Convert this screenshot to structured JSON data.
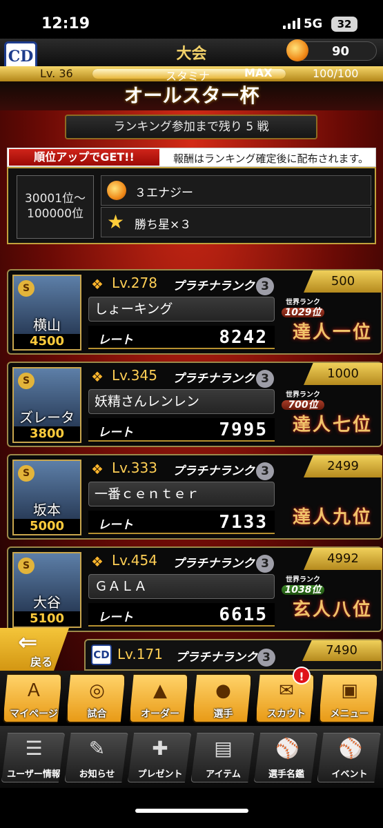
{
  "status": {
    "time": "12:19",
    "network": "5G",
    "battery": "32"
  },
  "header": {
    "logo": "CD",
    "title": "大会",
    "energy": "90"
  },
  "level": {
    "lv": "Lv. 36",
    "stamina_label": "スタミナ",
    "max": "MAX",
    "value": "100/100",
    "stamina_fraction": 1.0
  },
  "cup": {
    "title": "オールスター杯",
    "remaining": "ランキング参加まで残り 5 戦"
  },
  "reward": {
    "banner": "順位アップでGET!!",
    "note": "報酬はランキング確定後に配布されます。",
    "rank_range": [
      "30001位～",
      "100000位"
    ],
    "items": [
      {
        "icon": "energy-icon",
        "label": "３エナジー"
      },
      {
        "icon": "star-icon",
        "label": "勝ち星×３"
      }
    ]
  },
  "ranking": [
    {
      "player": "横山",
      "player_value": "4500",
      "level": "Lv.278",
      "rank_class": "プラチナランク",
      "rank_num": "3",
      "name": "しょーキング",
      "rate_label": "レート",
      "rate": "8242",
      "points": "500",
      "world_rank_label": "世界ランク",
      "world_rank": "1029位",
      "title": "達人一位"
    },
    {
      "player": "ズレータ",
      "player_value": "3800",
      "level": "Lv.345",
      "rank_class": "プラチナランク",
      "rank_num": "3",
      "name": "妖精さんレンレン",
      "rate_label": "レート",
      "rate": "7995",
      "points": "1000",
      "world_rank_label": "世界ランク",
      "world_rank": "700位",
      "title": "達人七位"
    },
    {
      "player": "坂本",
      "player_value": "5000",
      "level": "Lv.333",
      "rank_class": "プラチナランク",
      "rank_num": "3",
      "name": "一番ｃｅｎｔｅｒ",
      "rate_label": "レート",
      "rate": "7133",
      "points": "2499",
      "world_rank_label": "",
      "world_rank": "",
      "title": "達人九位"
    },
    {
      "player": "大谷",
      "player_value": "5100",
      "level": "Lv.454",
      "rank_class": "プラチナランク",
      "rank_num": "3",
      "name": "ＧＡＬＡ",
      "rate_label": "レート",
      "rate": "6615",
      "points": "4992",
      "world_rank_label": "世界ランク",
      "world_rank": "1038位",
      "title": "玄人八位"
    }
  ],
  "partial_row": {
    "logo": "CD",
    "level": "Lv.171",
    "rank_class": "プラチナランク",
    "rank_num": "3",
    "points": "7490"
  },
  "back": "戻る",
  "nav_main": [
    {
      "icon": "mypage-icon",
      "label": "マイページ"
    },
    {
      "icon": "stadium-icon",
      "label": "試合"
    },
    {
      "icon": "order-icon",
      "label": "オーダー"
    },
    {
      "icon": "player-icon",
      "label": "選手"
    },
    {
      "icon": "scout-icon",
      "label": "スカウト"
    },
    {
      "icon": "menu-icon",
      "label": "メニュー"
    }
  ],
  "scout_badge": "!",
  "nav_sub": [
    {
      "icon": "user-info-icon",
      "label": "ユーザー情報"
    },
    {
      "icon": "notice-icon",
      "label": "お知らせ"
    },
    {
      "icon": "present-icon",
      "label": "プレゼント"
    },
    {
      "icon": "item-icon",
      "label": "アイテム"
    },
    {
      "icon": "player-book-icon",
      "label": "選手名鑑"
    },
    {
      "icon": "event-icon",
      "label": "イベント"
    }
  ]
}
